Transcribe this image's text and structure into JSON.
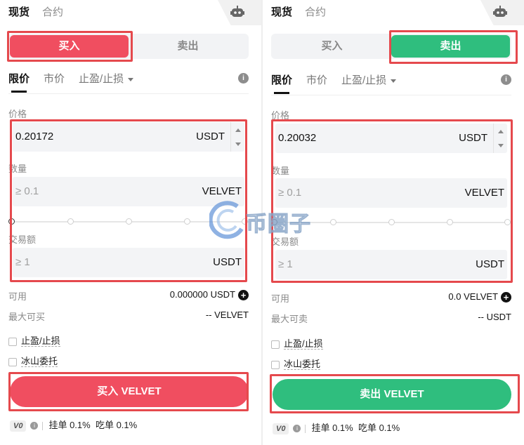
{
  "top_tabs": {
    "spot": "现货",
    "contract": "合约"
  },
  "side": {
    "buy": "买入",
    "sell": "卖出"
  },
  "order_types": {
    "limit": "限价",
    "market": "市价",
    "tpsl": "止盈/止损"
  },
  "labels": {
    "price": "价格",
    "amount": "数量",
    "total": "交易额",
    "available": "可用"
  },
  "left": {
    "price_value": "0.20172",
    "price_unit": "USDT",
    "amount_placeholder": "≥ 0.1",
    "amount_unit": "VELVET",
    "total_placeholder": "≥ 1",
    "total_unit": "USDT",
    "available_value": "0.000000 USDT",
    "max_label": "最大可买",
    "max_value": "-- VELVET",
    "submit_label": "买入 VELVET"
  },
  "right": {
    "price_value": "0.20032",
    "price_unit": "USDT",
    "amount_placeholder": "≥ 0.1",
    "amount_unit": "VELVET",
    "total_placeholder": "≥ 1",
    "total_unit": "USDT",
    "available_value": "0.0 VELVET",
    "max_label": "最大可卖",
    "max_value": "-- USDT",
    "submit_label": "卖出 VELVET"
  },
  "options": {
    "tpsl": "止盈/止损",
    "iceberg": "冰山委托"
  },
  "fees": {
    "vip": "V0",
    "maker": "挂单 0.1%",
    "taker": "吃单 0.1%"
  },
  "watermark": "币圈子",
  "colors": {
    "buy": "#f04e60",
    "sell": "#2fbe7e",
    "highlight": "#e5494d"
  }
}
